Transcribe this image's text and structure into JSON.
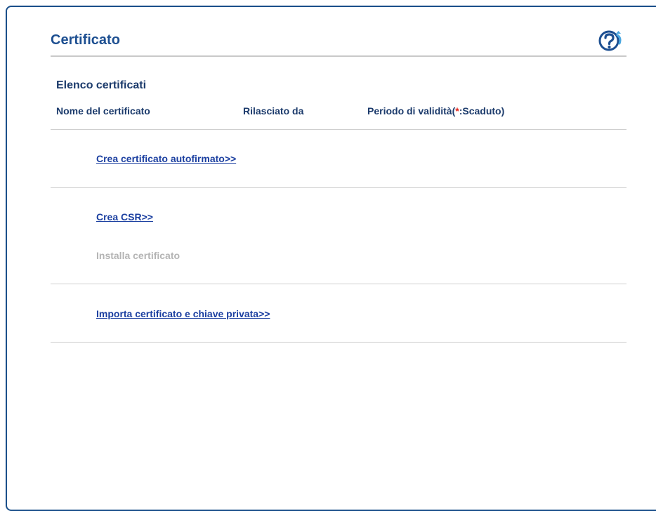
{
  "page": {
    "title": "Certificato",
    "help_icon": "help-question-icon"
  },
  "certificate_list": {
    "title": "Elenco certificati",
    "columns": {
      "name": "Nome del certificato",
      "issued_by": "Rilasciato da",
      "validity_prefix": "Periodo di validità(",
      "validity_marker": "*",
      "validity_suffix": ":Scaduto)"
    }
  },
  "actions": {
    "create_self_signed": "Crea certificato autofirmato>>",
    "create_csr": "Crea CSR>>",
    "install_certificate": "Installa certificato",
    "import_cert_key": "Importa certificato e chiave privata>>"
  },
  "colors": {
    "title": "#1d4f91",
    "link": "#1b3fa0",
    "disabled": "#b4b4b4",
    "required_marker": "#e2231a",
    "frame": "#1a4f8a"
  }
}
